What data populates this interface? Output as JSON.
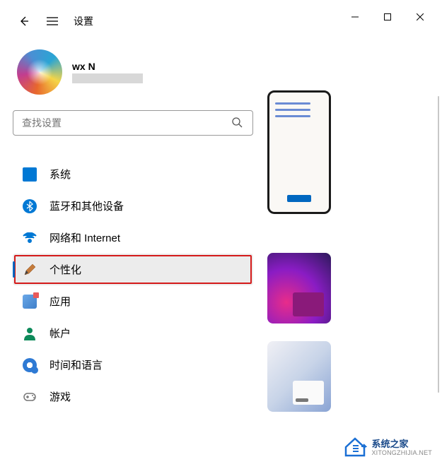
{
  "app": {
    "title": "设置"
  },
  "profile": {
    "name": "wx N"
  },
  "search": {
    "placeholder": "查找设置"
  },
  "nav": {
    "items": [
      {
        "label": "系统"
      },
      {
        "label": "蓝牙和其他设备"
      },
      {
        "label": "网络和 Internet"
      },
      {
        "label": "个性化"
      },
      {
        "label": "应用"
      },
      {
        "label": "帐户"
      },
      {
        "label": "时间和语言"
      },
      {
        "label": "游戏"
      }
    ],
    "active_index": 3
  },
  "watermark": {
    "title": "系统之家",
    "url": "XITONGZHIJIA.NET"
  }
}
